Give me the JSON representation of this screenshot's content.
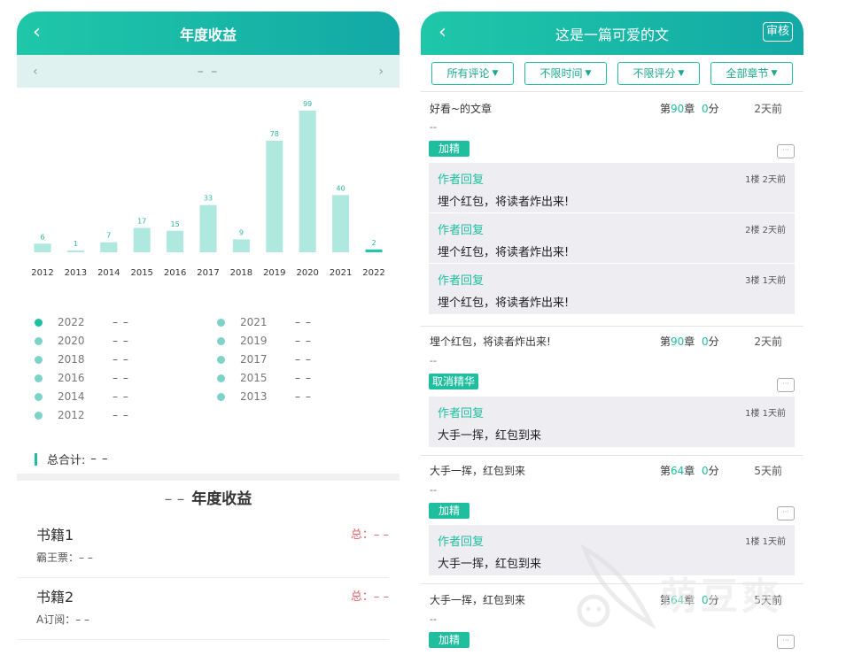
{
  "left": {
    "header": {
      "back_icon": "chevron-left-icon",
      "title": "年度收益"
    },
    "year_nav": {
      "prev_icon": "chevron-left-icon",
      "current": "– –",
      "next_icon": "chevron-right-icon"
    },
    "legend": [
      {
        "year": "2022",
        "value": "– –",
        "active": true
      },
      {
        "year": "2021",
        "value": "– –",
        "active": false
      },
      {
        "year": "2020",
        "value": "– –",
        "active": false
      },
      {
        "year": "2019",
        "value": "– –",
        "active": false
      },
      {
        "year": "2018",
        "value": "– –",
        "active": false
      },
      {
        "year": "2017",
        "value": "– –",
        "active": false
      },
      {
        "year": "2016",
        "value": "– –",
        "active": false
      },
      {
        "year": "2015",
        "value": "– –",
        "active": false
      },
      {
        "year": "2014",
        "value": "– –",
        "active": false
      },
      {
        "year": "2013",
        "value": "– –",
        "active": false
      },
      {
        "year": "2012",
        "value": "– –",
        "active": false
      }
    ],
    "total": {
      "label": "总合计:",
      "value": "– –"
    },
    "section": {
      "prefix": "– –",
      "title": "年度收益"
    },
    "books": [
      {
        "name": "书籍1",
        "total": "总：– –",
        "sub": "霸王票：– –"
      },
      {
        "name": "书籍2",
        "total": "总：– –",
        "sub": "A订阅：– –"
      }
    ],
    "colors": {
      "accent": "#1fbe9f",
      "bar": "#aee8df",
      "total_red": "#e8636b"
    }
  },
  "chart_data": {
    "type": "bar",
    "categories": [
      "2012",
      "2013",
      "2014",
      "2015",
      "2016",
      "2017",
      "2018",
      "2019",
      "2020",
      "2021",
      "2022"
    ],
    "values": [
      6,
      1,
      7,
      17,
      15,
      33,
      9,
      78,
      99,
      40,
      2
    ],
    "title": "",
    "xlabel": "",
    "ylabel": "",
    "ylim": [
      0,
      99
    ],
    "grid": false
  },
  "right": {
    "header": {
      "back_icon": "chevron-left-icon",
      "title": "这是一篇可爱的文",
      "audit": "审核"
    },
    "filters": [
      {
        "label": "所有评论"
      },
      {
        "label": "不限时间"
      },
      {
        "label": "不限评分"
      },
      {
        "label": "全部章节"
      }
    ],
    "comments": [
      {
        "text": "好看~的文章",
        "chapter_prefix": "第",
        "chapter": "90",
        "chapter_suffix": "章",
        "score": "0",
        "score_suffix": "分",
        "ago": "2天前",
        "dash": "--",
        "tag": "加精",
        "replies": [
          {
            "who": "作者回复",
            "floor": "1楼 2天前",
            "msg": "埋个红包，将读者炸出来!"
          },
          {
            "who": "作者回复",
            "floor": "2楼 2天前",
            "msg": "埋个红包，将读者炸出来!"
          },
          {
            "who": "作者回复",
            "floor": "3楼 1天前",
            "msg": "埋个红包，将读者炸出来!"
          }
        ]
      },
      {
        "text": "埋个红包，将读者炸出来!",
        "chapter_prefix": "第",
        "chapter": "90",
        "chapter_suffix": "章",
        "score": "0",
        "score_suffix": "分",
        "ago": "2天前",
        "dash": "--",
        "tag": "取消精华",
        "replies": [
          {
            "who": "作者回复",
            "floor": "1楼 1天前",
            "msg": "大手一挥，红包到来"
          }
        ]
      },
      {
        "text": "大手一挥，红包到来",
        "chapter_prefix": "第",
        "chapter": "64",
        "chapter_suffix": "章",
        "score": "0",
        "score_suffix": "分",
        "ago": "5天前",
        "dash": "--",
        "tag": "加精",
        "replies": [
          {
            "who": "作者回复",
            "floor": "1楼 1天前",
            "msg": "大手一挥，红包到来"
          }
        ]
      },
      {
        "text": "大手一挥，红包到来",
        "chapter_prefix": "第",
        "chapter": "64",
        "chapter_suffix": "章",
        "score": "0",
        "score_suffix": "分",
        "ago": "5天前",
        "dash": "--",
        "tag": "加精",
        "replies": []
      }
    ],
    "bubble_icon": "comment-bubble-icon"
  },
  "watermark": {
    "text": "萌豆爽"
  }
}
